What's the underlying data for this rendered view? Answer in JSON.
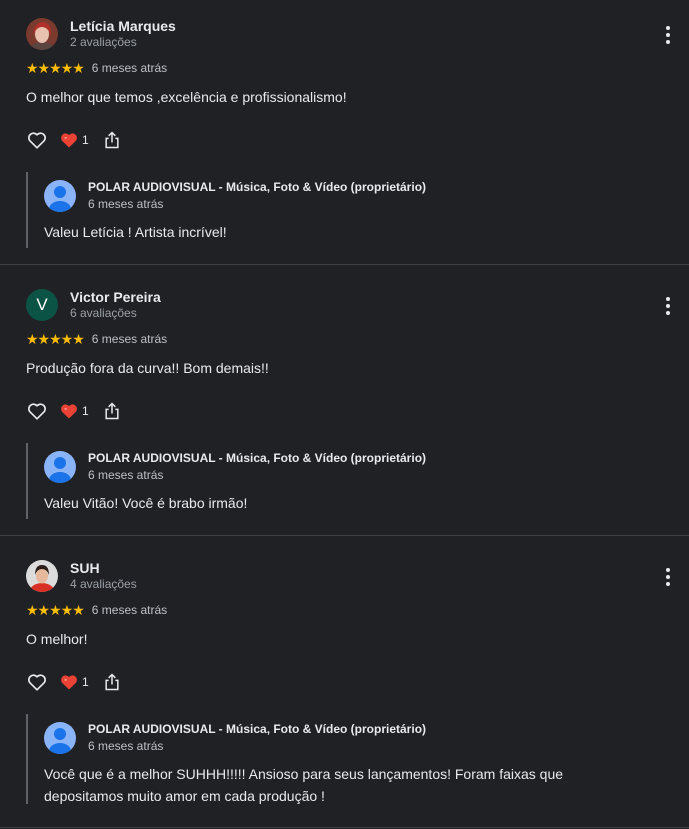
{
  "reviews": [
    {
      "author": "Letícia Marques",
      "review_count": "2 avaliações",
      "rating": 5,
      "stars": "★★★★★",
      "time": "6 meses atrás",
      "text": "O melhor que temos ,excelência e profissionalismo!",
      "reaction_count": "1",
      "owner_reply": {
        "name": "POLAR AUDIOVISUAL - Música, Foto & Vídeo (proprietário)",
        "time": "6 meses atrás",
        "text": "Valeu Letícia ! Artista incrível!"
      }
    },
    {
      "author": "Victor Pereira",
      "avatar_letter": "V",
      "review_count": "6 avaliações",
      "rating": 5,
      "stars": "★★★★★",
      "time": "6 meses atrás",
      "text": "Produção fora da curva!! Bom demais!!",
      "reaction_count": "1",
      "owner_reply": {
        "name": "POLAR AUDIOVISUAL - Música, Foto & Vídeo (proprietário)",
        "time": "6 meses atrás",
        "text": "Valeu Vitão! Você é brabo irmão!"
      }
    },
    {
      "author": "SUH",
      "review_count": "4 avaliações",
      "rating": 5,
      "stars": "★★★★★",
      "time": "6 meses atrás",
      "text": "O melhor!",
      "reaction_count": "1",
      "owner_reply": {
        "name": "POLAR AUDIOVISUAL - Música, Foto & Vídeo (proprietário)",
        "time": "6 meses atrás",
        "text": "Você que é a melhor SUHHH!!!!! Ansioso para seus lançamentos! Foram faixas que depositamos muito amor em cada produção !"
      }
    }
  ],
  "icons": {
    "like": "heart-outline-icon",
    "reaction": "red-heart-icon",
    "share": "share-icon",
    "menu": "more-vert-icon"
  },
  "colors": {
    "background": "#202124",
    "star": "#fbbc04",
    "reaction_heart": "#ea4335",
    "owner_avatar": "#8ab4f8",
    "victor_avatar": "#0b5345"
  }
}
